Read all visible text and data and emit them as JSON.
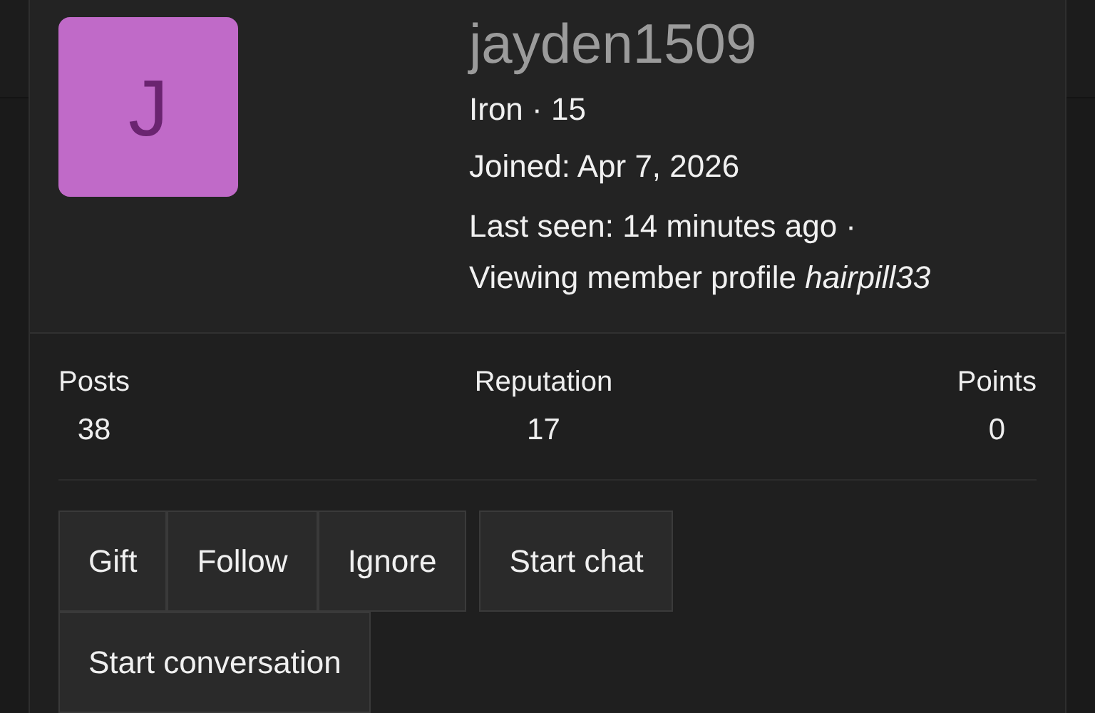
{
  "profile": {
    "avatar_letter": "J",
    "username": "jayden1509",
    "rank": "Iron · 15",
    "joined": "Joined: Apr 7, 2026",
    "last_seen": "Last seen: 14 minutes ago ·",
    "activity": "Viewing member profile *hairpill33*"
  },
  "stats": [
    {
      "label": "Posts",
      "value": "38"
    },
    {
      "label": "Reputation",
      "value": "17"
    },
    {
      "label": "Points",
      "value": "0"
    }
  ],
  "button_groups": [
    [
      "Gift",
      "Follow",
      "Ignore"
    ],
    [
      "Start chat"
    ],
    [
      "Start conversation"
    ]
  ]
}
